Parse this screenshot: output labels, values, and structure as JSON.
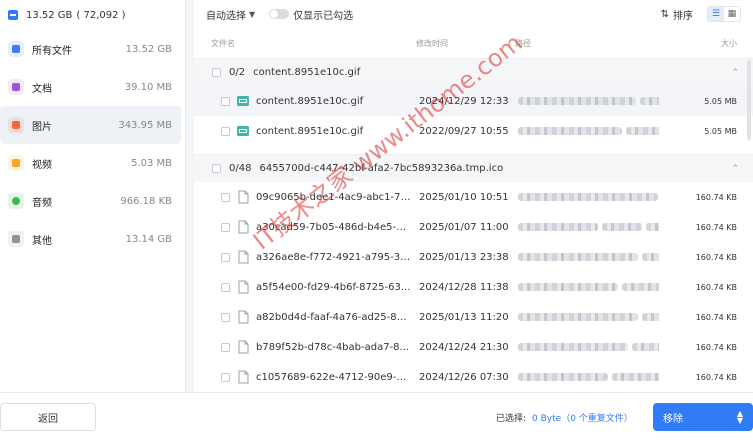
{
  "sidebar": {
    "total": "13.52 GB",
    "total_count": "( 72,092 )",
    "items": [
      {
        "label": "所有文件",
        "size": "13.52 GB",
        "icon": "folder-icon",
        "color": "#3d7bf5"
      },
      {
        "label": "文档",
        "size": "39.10 MB",
        "icon": "document-icon",
        "color": "#9b59d0"
      },
      {
        "label": "图片",
        "size": "343.95 MB",
        "icon": "image-icon",
        "color": "#f06a3c"
      },
      {
        "label": "视频",
        "size": "5.03 MB",
        "icon": "video-icon",
        "color": "#f5a623"
      },
      {
        "label": "音频",
        "size": "966.18 KB",
        "icon": "microphone-icon",
        "color": "#3cba54"
      },
      {
        "label": "其他",
        "size": "13.14 GB",
        "icon": "grid-icon",
        "color": "#8a94a6"
      }
    ]
  },
  "toolbar": {
    "auto_select": "自动选择",
    "only_checked": "仅显示已勾选",
    "sort": "排序"
  },
  "columns": {
    "name": "文件名",
    "date": "修改时间",
    "path": "路径",
    "size": "大小"
  },
  "groups": [
    {
      "count": "0/2",
      "name": "content.8951e10c.gif",
      "files": [
        {
          "name": "content.8951e10c.gif",
          "date": "2024/12/29 12:33",
          "size": "5.05 MB",
          "type": "gif"
        },
        {
          "name": "content.8951e10c.gif",
          "date": "2022/09/27 10:55",
          "size": "5.05 MB",
          "type": "gif"
        }
      ]
    },
    {
      "count": "0/48",
      "name": "6455700d-c447-42bf-afa2-7bc5893236a.tmp.ico",
      "files": [
        {
          "name": "09c9065b-dee1-4ac9-abc1-77...",
          "date": "2025/01/10 10:51",
          "size": "160.74 KB",
          "type": "file"
        },
        {
          "name": "a30cad59-7b05-486d-b4e5-0...",
          "date": "2025/01/07 11:00",
          "size": "160.74 KB",
          "type": "file"
        },
        {
          "name": "a326ae8e-f772-4921-a795-3a...",
          "date": "2025/01/13 23:38",
          "size": "160.74 KB",
          "type": "file"
        },
        {
          "name": "a5f54e00-fd29-4b6f-8725-63...",
          "date": "2024/12/28 11:38",
          "size": "160.74 KB",
          "type": "file"
        },
        {
          "name": "a82b0d4d-faaf-4a76-ad25-88...",
          "date": "2025/01/13 11:20",
          "size": "160.74 KB",
          "type": "file"
        },
        {
          "name": "b789f52b-d78c-4bab-ada7-8...",
          "date": "2024/12/24 21:30",
          "size": "160.74 KB",
          "type": "file"
        },
        {
          "name": "c1057689-622e-4712-90e9-c1...",
          "date": "2024/12/26 07:30",
          "size": "160.74 KB",
          "type": "file"
        }
      ]
    }
  ],
  "bottom": {
    "back": "返回",
    "selected_label": "已选择:",
    "selected_value": "0 Byte（0 个重复文件）",
    "move": "移除"
  },
  "watermark": "IT技术之家 www.ithome.com"
}
